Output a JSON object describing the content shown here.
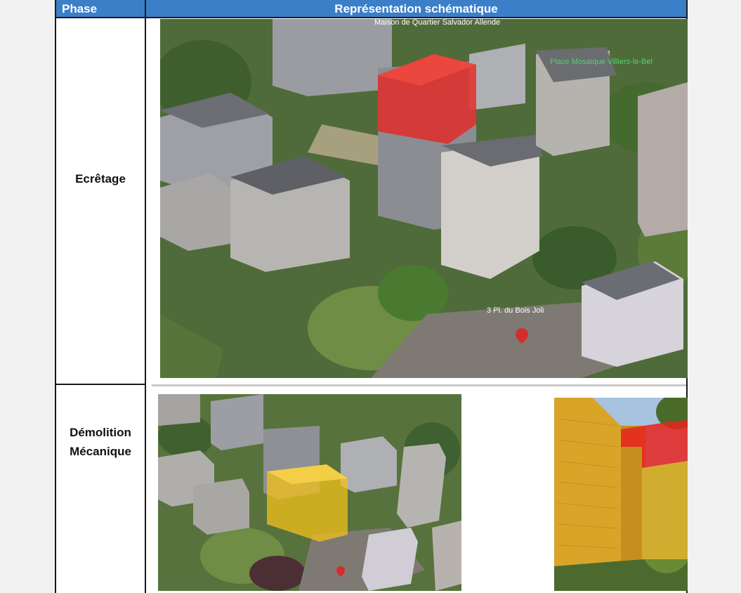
{
  "header": {
    "phase": "Phase",
    "representation": "Représentation schématique"
  },
  "rows": [
    {
      "phase": "Ecrêtage",
      "map_labels": {
        "top": "Maison de Quartier Salvador Allende",
        "place": "Place Mosaïque Villiers-le-Bel",
        "address": "3 Pl. du Bois Joli"
      }
    },
    {
      "phase_line1": "Démolition",
      "phase_line2": "Mécanique"
    }
  ],
  "colors": {
    "header_bg": "#3a7fc8",
    "highlight_ecretage": "#e8231f",
    "highlight_demolition": "#f3c21a",
    "map_green": "#5d7a3e"
  }
}
